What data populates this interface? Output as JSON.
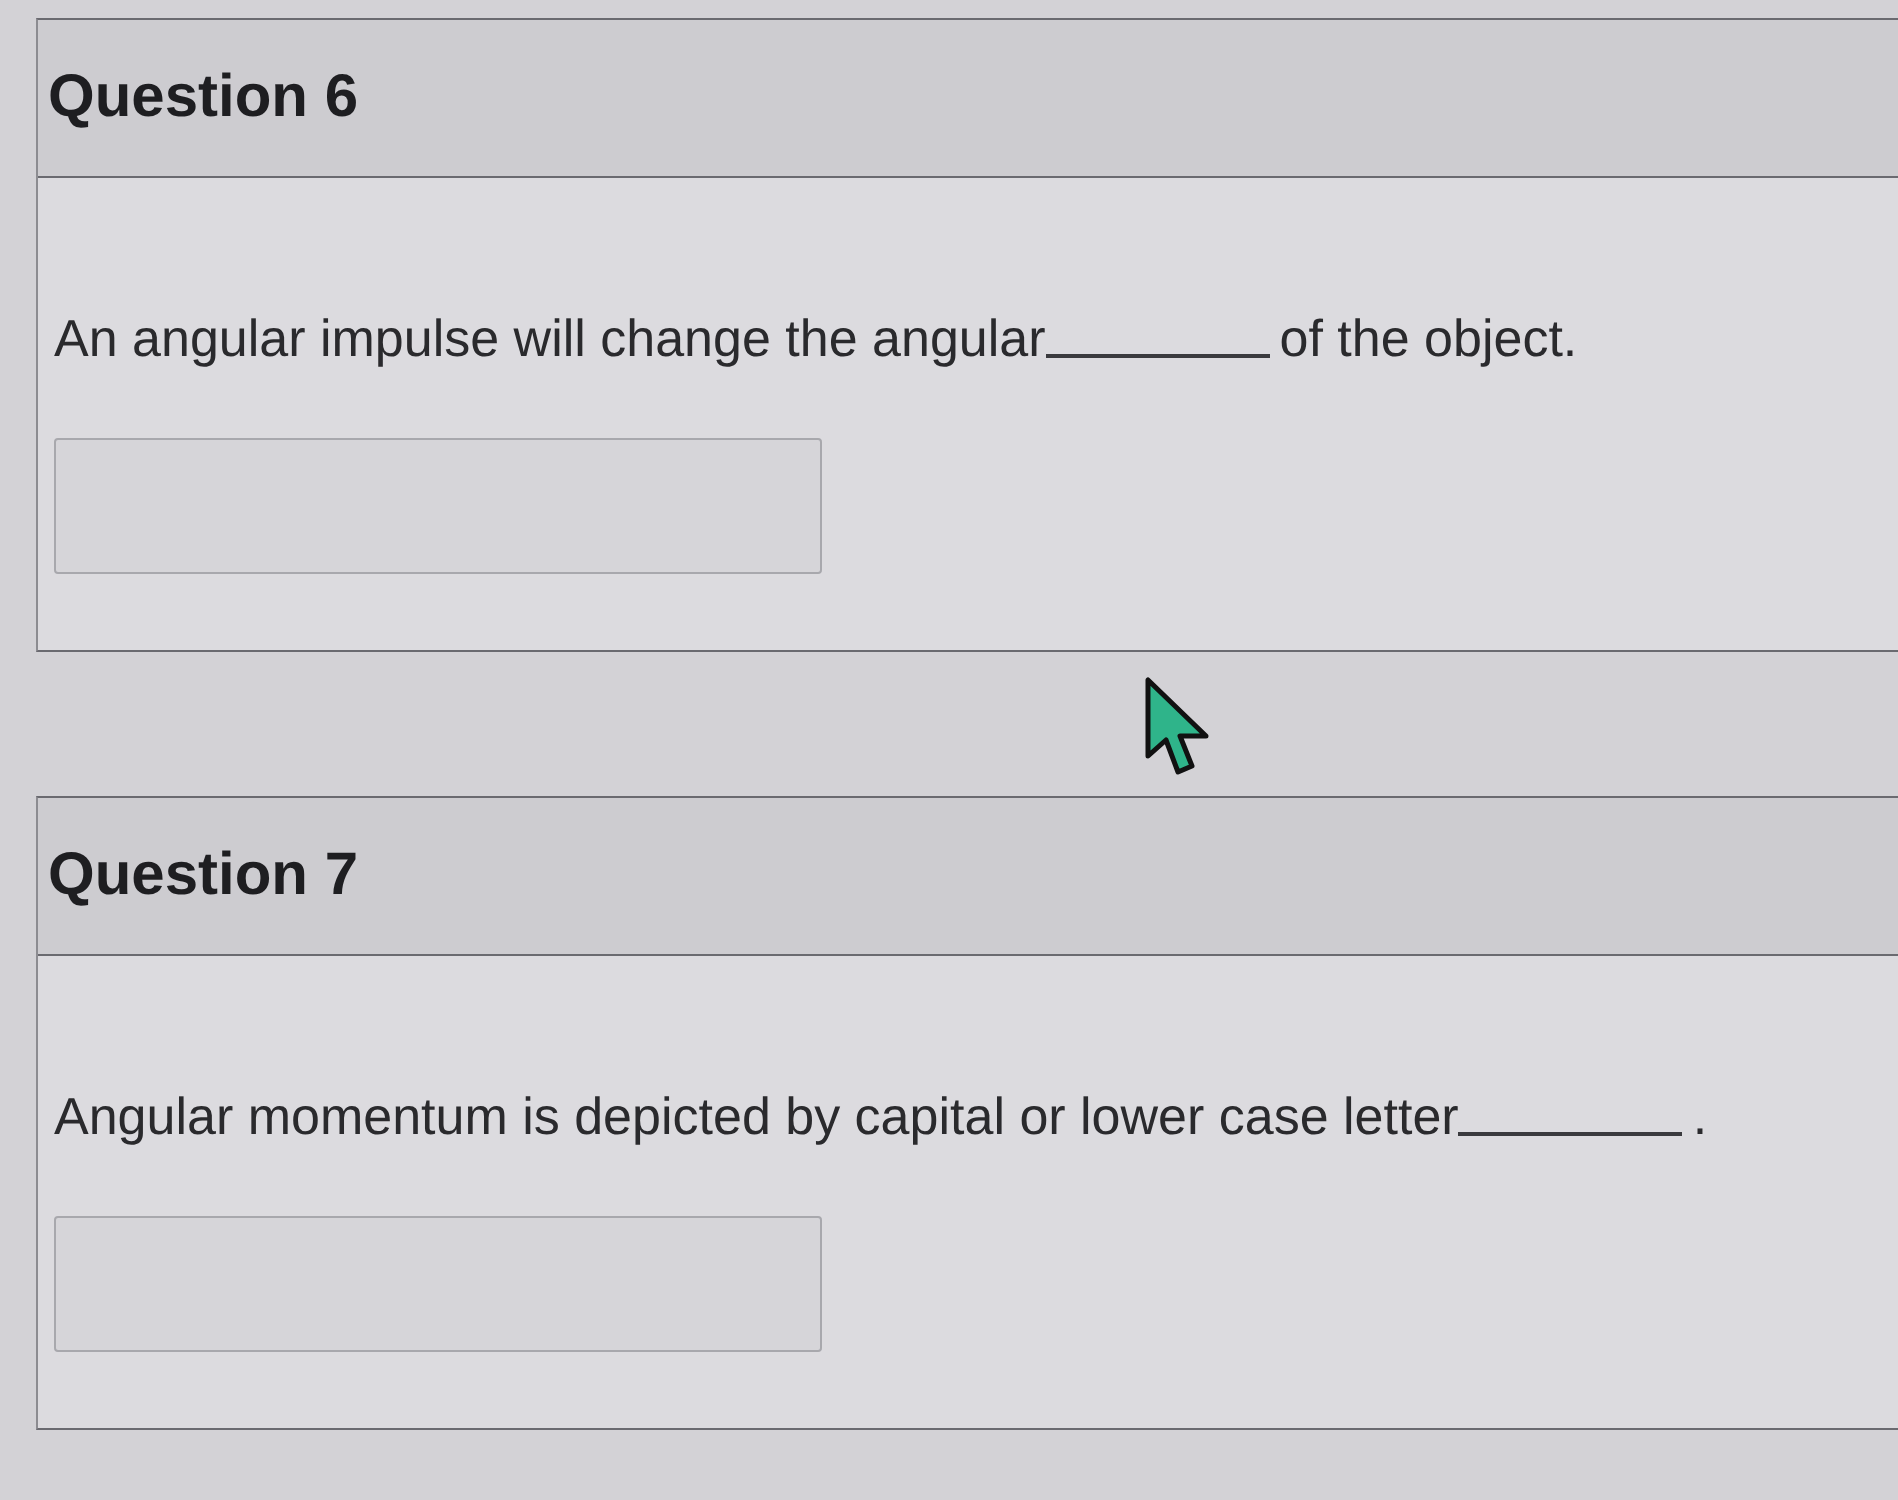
{
  "questions": [
    {
      "title": "Question 6",
      "prompt": [
        {
          "kind": "text",
          "text": "An angular impulse will change the angular"
        },
        {
          "kind": "blank"
        },
        {
          "kind": "text",
          "text": "of the object."
        }
      ]
    },
    {
      "title": "Question 7",
      "prompt": [
        {
          "kind": "text",
          "text": "Angular momentum is depicted by capital or lower case letter"
        },
        {
          "kind": "blank"
        },
        {
          "kind": "text",
          "text": "."
        }
      ]
    }
  ]
}
